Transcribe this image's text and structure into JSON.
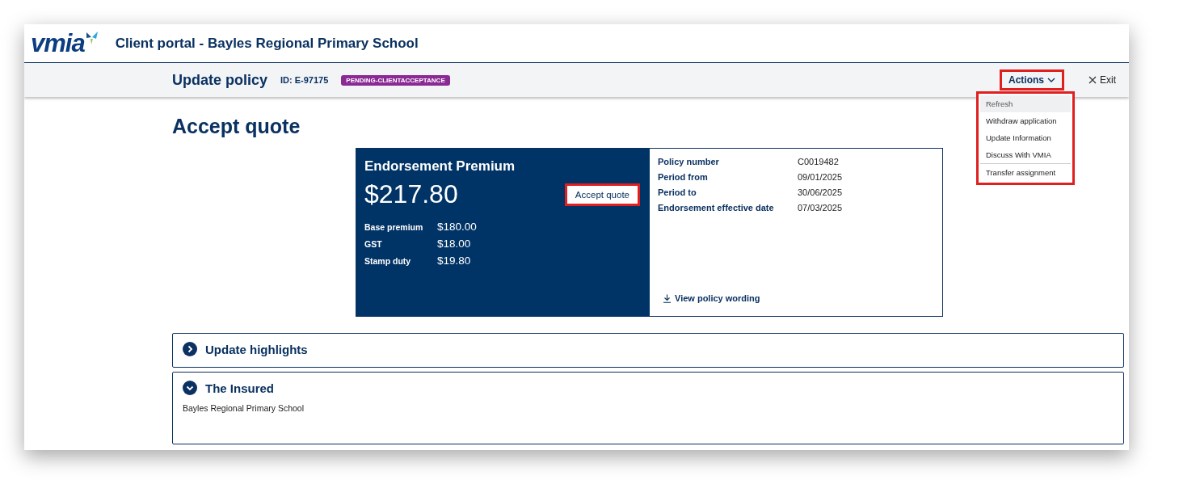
{
  "header": {
    "logo": "vmia",
    "title": "Client portal - Bayles Regional Primary School"
  },
  "subbar": {
    "title": "Update policy",
    "id": "ID: E-97175",
    "status": "PENDING-CLIENTACCEPTANCE",
    "actions": {
      "label": "Actions",
      "expanded": true,
      "highlighted": true
    },
    "exit": "Exit"
  },
  "actions_menu": {
    "highlighted": true,
    "items": [
      {
        "label": "Refresh",
        "selected": true,
        "divider_before": false
      },
      {
        "label": "Withdraw application",
        "selected": false,
        "divider_before": false
      },
      {
        "label": "Update Information",
        "selected": false,
        "divider_before": false
      },
      {
        "label": "Discuss With VMIA",
        "selected": false,
        "divider_before": false
      },
      {
        "label": "Transfer assignment",
        "selected": false,
        "divider_before": true
      }
    ]
  },
  "page_title": "Accept quote",
  "premium": {
    "title": "Endorsement Premium",
    "amount": "$217.80",
    "accept": {
      "label": "Accept quote",
      "highlighted": true
    },
    "breakdown": [
      {
        "label": "Base premium",
        "value": "$180.00"
      },
      {
        "label": "GST",
        "value": "$18.00"
      },
      {
        "label": "Stamp duty",
        "value": "$19.80"
      }
    ]
  },
  "policy_details": [
    {
      "label": "Policy number",
      "value": "C0019482"
    },
    {
      "label": "Period from",
      "value": "09/01/2025"
    },
    {
      "label": "Period to",
      "value": "30/06/2025"
    },
    {
      "label": "Endorsement effective date",
      "value": "07/03/2025"
    }
  ],
  "view_wording": "View policy wording",
  "sections": [
    {
      "title": "Update highlights",
      "expanded": false
    },
    {
      "title": "The Insured",
      "expanded": true,
      "body": "Bayles Regional Primary School"
    }
  ]
}
